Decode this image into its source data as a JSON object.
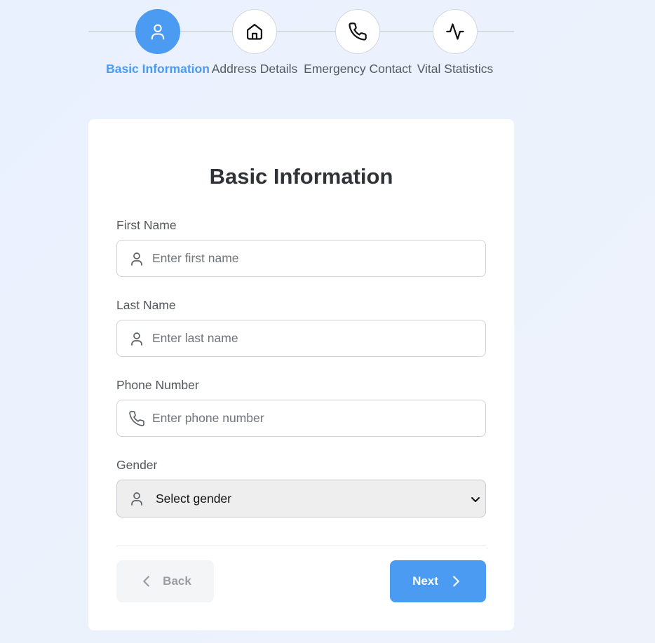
{
  "stepper": {
    "steps": [
      {
        "label": "Basic Information",
        "icon": "user-icon",
        "active": true
      },
      {
        "label": "Address Details",
        "icon": "home-icon",
        "active": false
      },
      {
        "label": "Emergency Contact",
        "icon": "phone-icon",
        "active": false
      },
      {
        "label": "Vital Statistics",
        "icon": "activity-icon",
        "active": false
      }
    ]
  },
  "form": {
    "title": "Basic Information",
    "first_name": {
      "label": "First Name",
      "placeholder": "Enter first name",
      "value": "",
      "icon": "user-icon"
    },
    "last_name": {
      "label": "Last Name",
      "placeholder": "Enter last name",
      "value": "",
      "icon": "user-icon"
    },
    "phone": {
      "label": "Phone Number",
      "placeholder": "Enter phone number",
      "value": "",
      "icon": "phone-icon"
    },
    "gender": {
      "label": "Gender",
      "selected": "Select gender",
      "icon": "user-icon"
    }
  },
  "actions": {
    "back_label": "Back",
    "next_label": "Next"
  },
  "colors": {
    "accent": "#4c9bf2",
    "background": "#eaf1fe",
    "card": "#ffffff",
    "back_button_bg": "#f4f5f6",
    "select_bg": "#eeeeee"
  }
}
